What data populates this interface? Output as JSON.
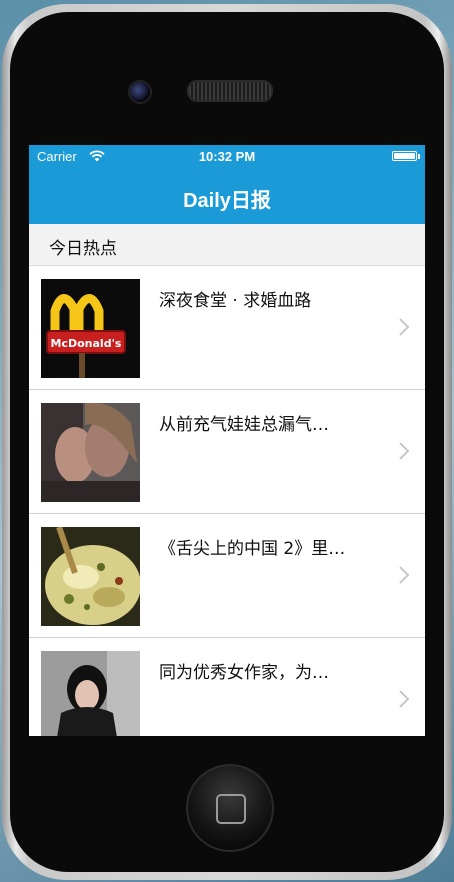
{
  "status_bar": {
    "carrier": "Carrier",
    "time": "10:32 PM",
    "wifi_icon": "wifi-icon",
    "battery_icon": "battery-icon"
  },
  "nav": {
    "title": "Daily日报"
  },
  "section": {
    "title": "今日热点"
  },
  "stories": [
    {
      "title": "深夜食堂 · 求婚血路",
      "thumb": "mcdonalds-sign-image"
    },
    {
      "title": "从前充气娃娃总漏气…",
      "thumb": "couple-kissing-image"
    },
    {
      "title": "《舌尖上的中国 2》里…",
      "thumb": "food-dish-image"
    },
    {
      "title": "同为优秀女作家，为…",
      "thumb": "woman-portrait-image"
    }
  ],
  "colors": {
    "accent": "#1a9ad7",
    "section_bg": "#f2f2f2",
    "chevron": "#c7c7cc"
  }
}
